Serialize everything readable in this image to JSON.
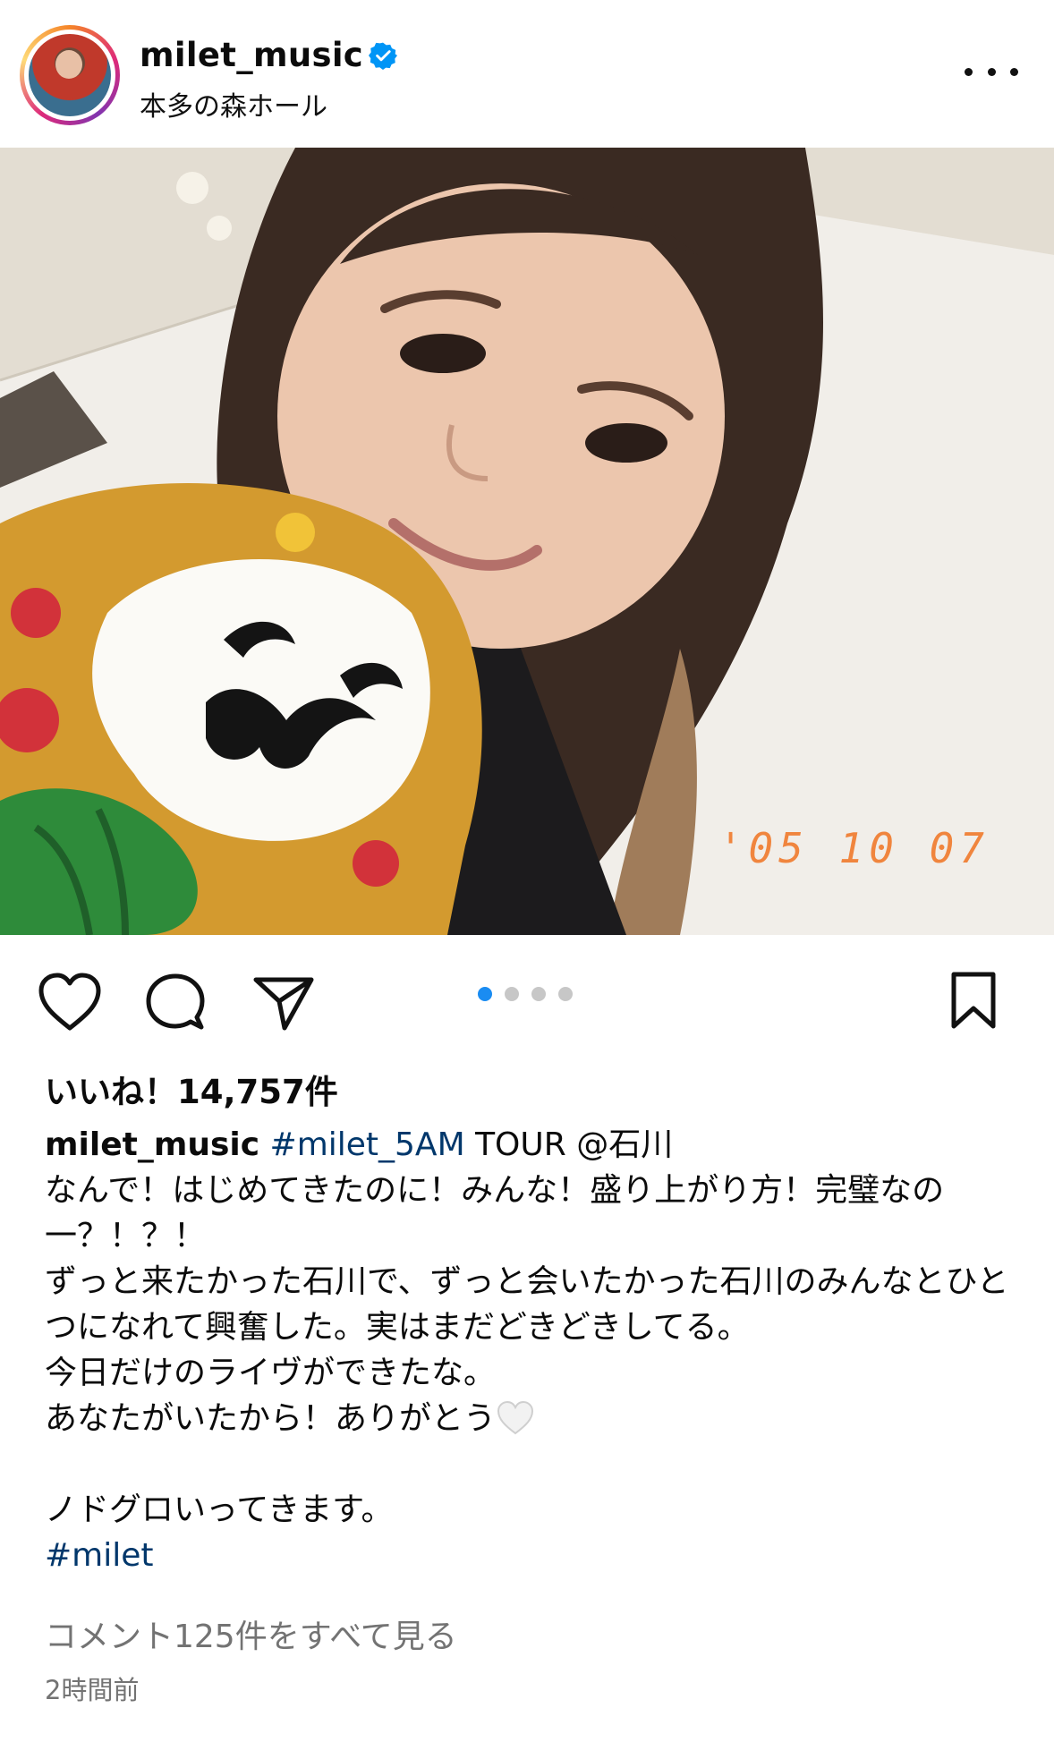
{
  "header": {
    "username": "milet_music",
    "location": "本多の森ホール"
  },
  "photo": {
    "date_stamp": "'05 10 07"
  },
  "carousel": {
    "count": 4,
    "active_index": 0
  },
  "likes": {
    "label": "いいね！14,757件"
  },
  "caption": {
    "username": "milet_music",
    "hashtag1": "#milet_5AM",
    "line1_rest": " TOUR @石川",
    "body": "なんで！はじめてきたのに！みんな！盛り上がり方！完璧なの一？！？！\nずっと来たかった石川で、ずっと会いたかった石川のみんなとひとつになれて興奮した。実はまだどきどきしてる。\n今日だけのライヴができたな。\nあなたがいたから！ありがとう",
    "body2": "\n\nノドグロいってきます。",
    "hashtag2": "#milet"
  },
  "comments": {
    "label": "コメント125件をすべて見る"
  },
  "timestamp": "2時間前",
  "colors": {
    "accent_blue": "#1a8cf2",
    "hashtag": "#00376b",
    "muted": "#737373"
  }
}
